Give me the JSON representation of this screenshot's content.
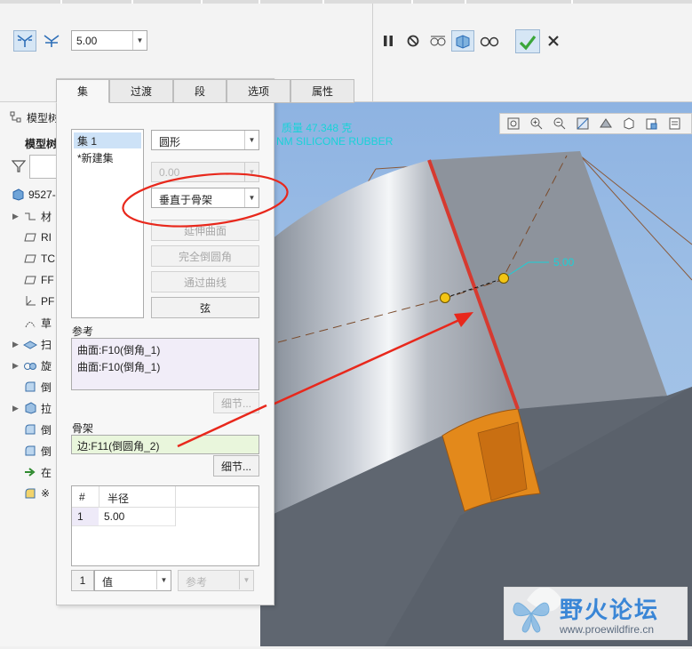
{
  "ribbon": {
    "value": "5.00",
    "icons": [
      "y-branch-icon",
      "y-branch-alt-icon",
      "pause-icon",
      "no-icon",
      "preview-glasses-icon",
      "geometry-preview-icon",
      "verify-glasses-icon",
      "confirm-check-icon",
      "close-x-icon"
    ]
  },
  "tabs": [
    "集",
    "过渡",
    "段",
    "选项",
    "属性"
  ],
  "sets": {
    "items": [
      "集 1",
      "*新建集"
    ]
  },
  "shape_select": "圆形",
  "disabled_value": "0.00",
  "section_select": "垂直于骨架",
  "buttons": {
    "extend": "延伸曲面",
    "full_round": "完全倒圆角",
    "through_curve": "通过曲线",
    "chord": "弦",
    "details1": "细节...",
    "details2": "细节..."
  },
  "refs": {
    "label": "参考",
    "items": [
      "曲面:F10(倒角_1)",
      "曲面:F10(倒角_1)"
    ]
  },
  "spine": {
    "label": "骨架",
    "value": "边:F11(倒圆角_2)"
  },
  "radius_table": {
    "headers": [
      "#",
      "半径"
    ],
    "rows": [
      [
        "1",
        "5.00"
      ]
    ]
  },
  "bottom": {
    "index": "1",
    "mode": "值",
    "ref": "参考"
  },
  "tree": {
    "title": "模型树",
    "subtitle": "模型树",
    "part": "9527-",
    "items": [
      "材",
      "RI",
      "TC",
      "FF",
      "PF",
      "草",
      "扫",
      "旋",
      "倒",
      "拉",
      "倒",
      "倒",
      "在",
      "※"
    ]
  },
  "viewport": {
    "cyan_line1": "质量 47.348 克",
    "cyan_line2": "NM SILICONE RUBBER",
    "dim_label": "5.00"
  },
  "watermark": {
    "title": "野火论坛",
    "url": "www.proewildfire.cn"
  },
  "colors": {
    "accent_blue": "#3a83c9",
    "annotation_red": "#e8281c",
    "confirm_green": "#3aa63a",
    "round_orange": "#e3891b",
    "viewport_bg": "#98bbe6"
  }
}
